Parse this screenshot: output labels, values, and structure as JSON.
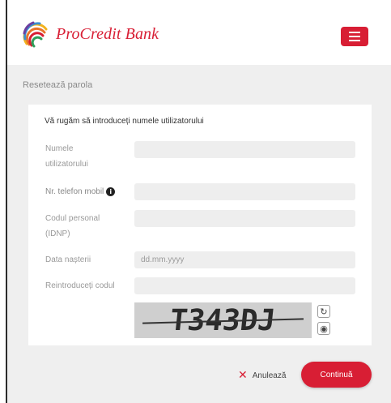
{
  "header": {
    "brand_name": "ProCredit Bank",
    "menu_icon": "hamburger-menu-icon",
    "brand_color": "#d81e34"
  },
  "page": {
    "section_title": "Resetează parola"
  },
  "form": {
    "heading": "Vă rugăm să introduceți numele utilizatorului",
    "username": {
      "label_line1": "Numele",
      "label_line2": "utilizatorului",
      "value": "",
      "placeholder": ""
    },
    "phone": {
      "label": "Nr. telefon mobil",
      "info_icon": "info-icon",
      "value": "",
      "placeholder": ""
    },
    "personal_code": {
      "label_line1": "Codul personal",
      "label_line2": "(IDNP)",
      "value": "",
      "placeholder": ""
    },
    "birth_date": {
      "label": "Data nașterii",
      "value": "",
      "placeholder": "dd.mm.yyyy"
    },
    "captcha_input": {
      "label": "Reintroduceți codul",
      "value": "",
      "placeholder": ""
    },
    "captcha": {
      "code": "T343DJ",
      "refresh_icon": "refresh-icon",
      "audio_icon": "audio-icon"
    }
  },
  "actions": {
    "cancel_label": "Anulează",
    "cancel_icon": "close-icon",
    "continue_label": "Continuă"
  }
}
